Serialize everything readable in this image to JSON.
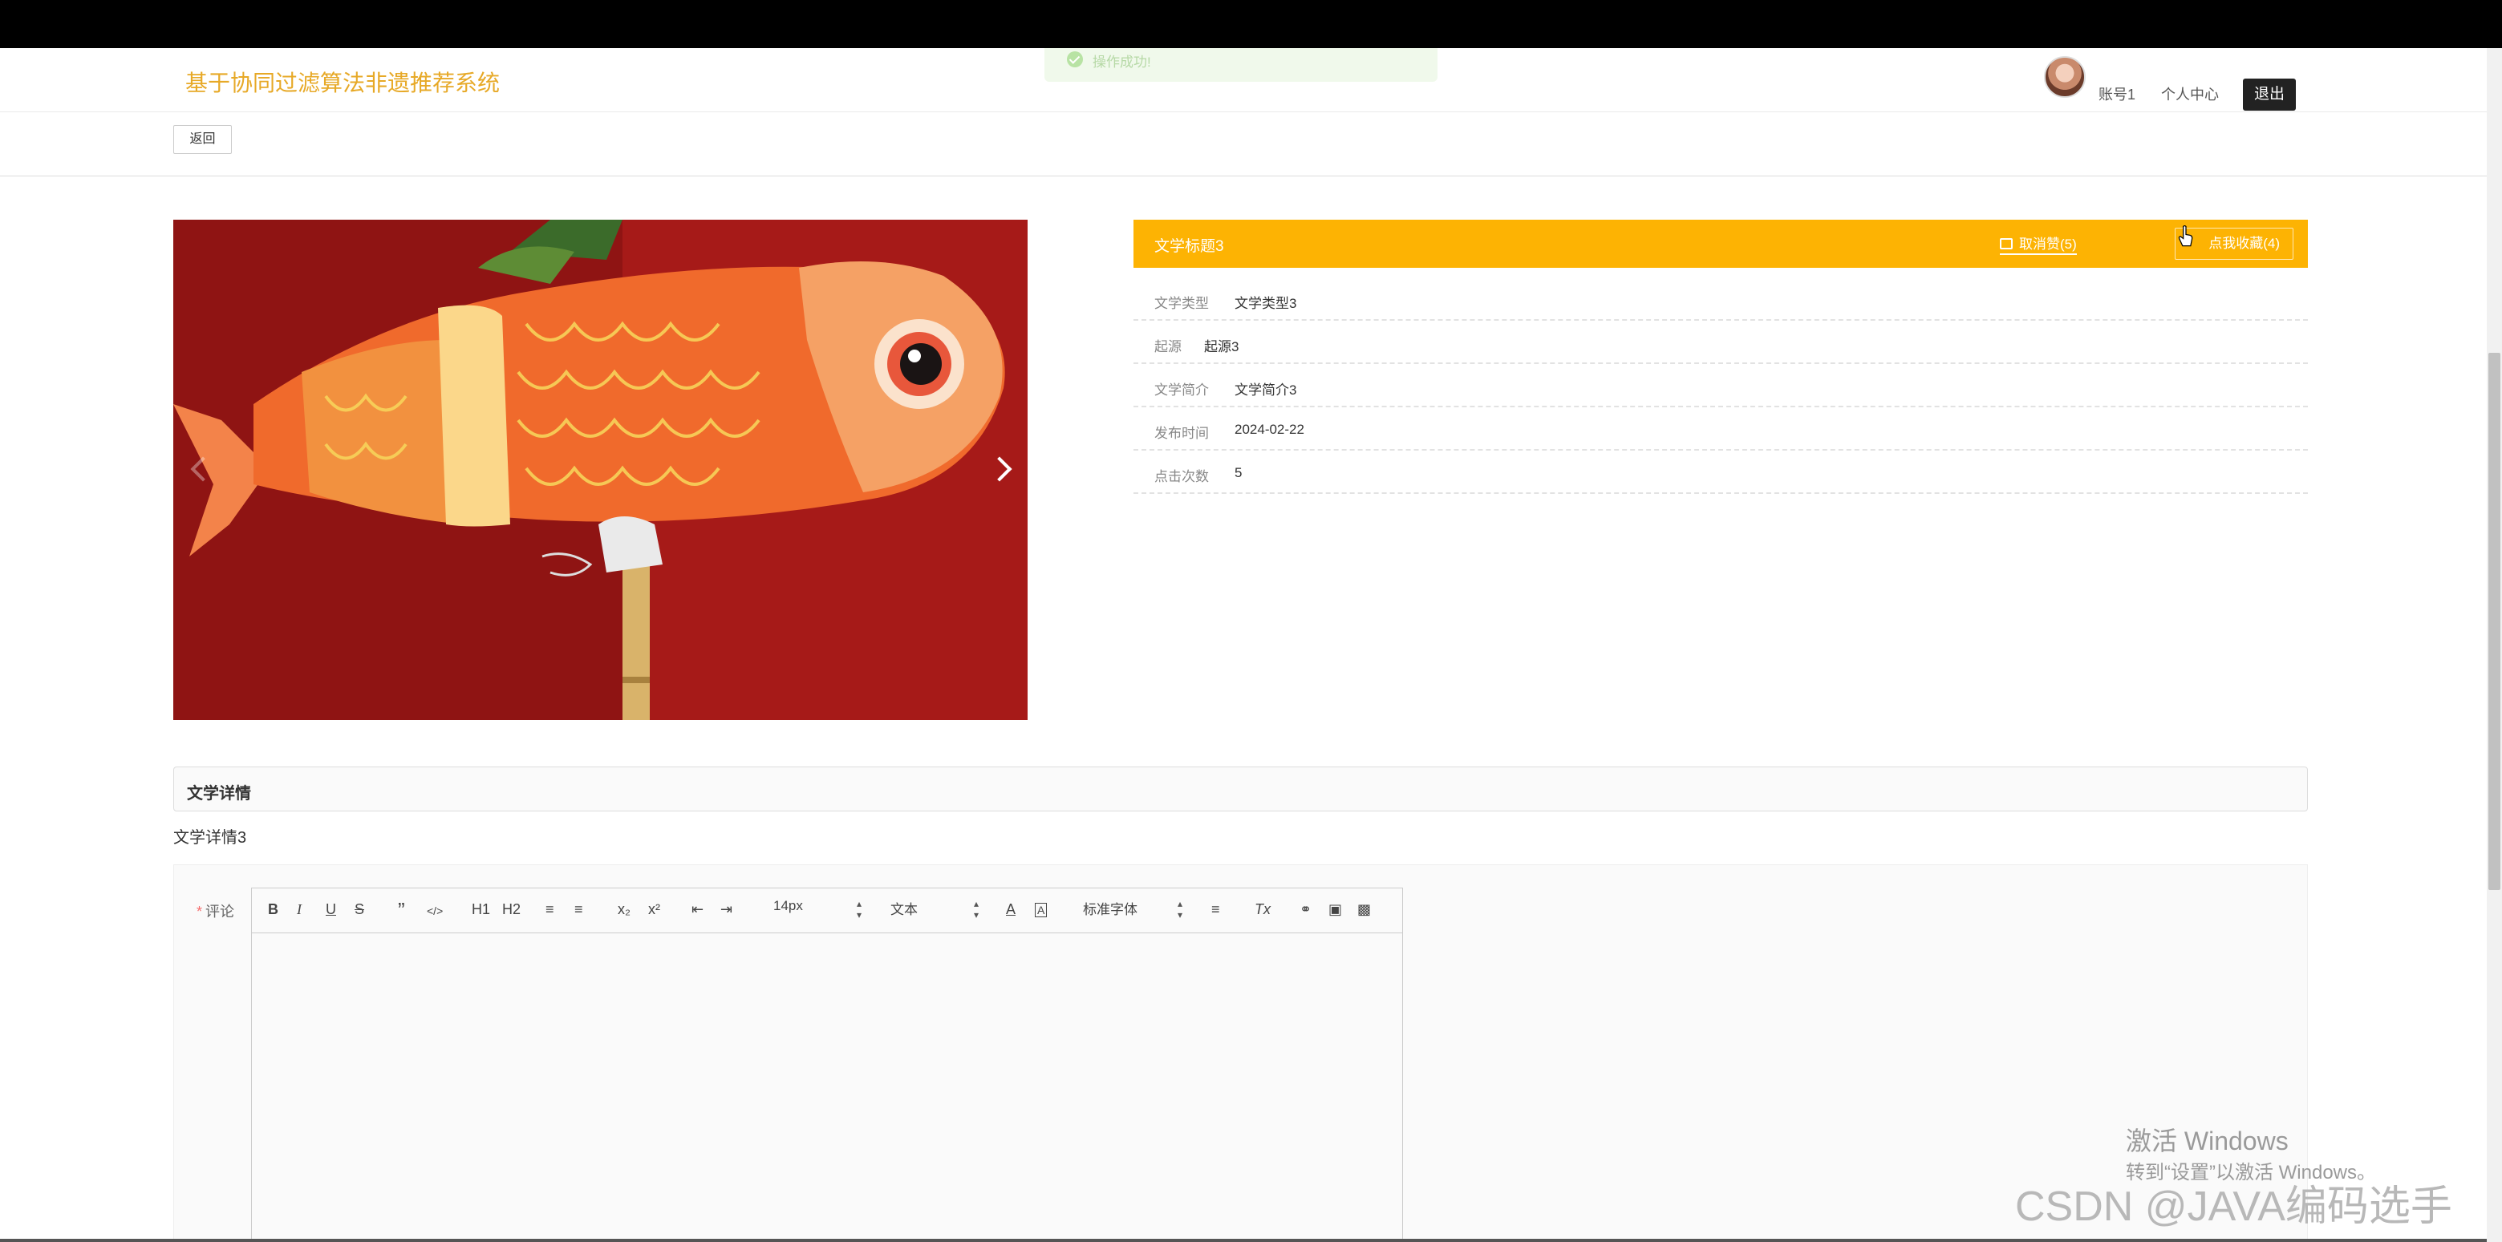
{
  "header": {
    "site_title": "基于协同过滤算法非遗推荐系统",
    "toast_message": "操作成功!",
    "user_name": "账号1",
    "personal_center": "个人中心",
    "logout": "退出"
  },
  "subbar": {
    "back_label": "返回"
  },
  "detail": {
    "title": "文学标题3",
    "like_label": "取消赞(5)",
    "favorite_label": "点我收藏(4)",
    "fields": [
      {
        "label": "文学类型",
        "value": "文学类型3"
      },
      {
        "label": "起源",
        "value": "起源3"
      },
      {
        "label": "文学简介",
        "value": "文学简介3"
      },
      {
        "label": "发布时间",
        "value": "2024-02-22"
      },
      {
        "label": "点击次数",
        "value": "5"
      }
    ]
  },
  "section": {
    "heading": "文学详情",
    "content": "文学详情3"
  },
  "comment": {
    "required_mark": "*",
    "label": "评论",
    "toolbar": {
      "bold": "B",
      "italic": "I",
      "underline": "U",
      "strike": "S",
      "quote": "”",
      "code": "</>",
      "h1": "H1",
      "h2": "H2",
      "subscript": "x₂",
      "superscript": "x²",
      "size": "14px",
      "header": "文本",
      "font": "标准字体",
      "clear": "Tx"
    }
  },
  "watermarks": {
    "activate_title": "激活 Windows",
    "activate_sub": "转到“设置”以激活 Windows。",
    "csdn": "CSDN @JAVA编码选手"
  },
  "colors": {
    "accent": "#fdb303",
    "title": "#e7a927"
  }
}
